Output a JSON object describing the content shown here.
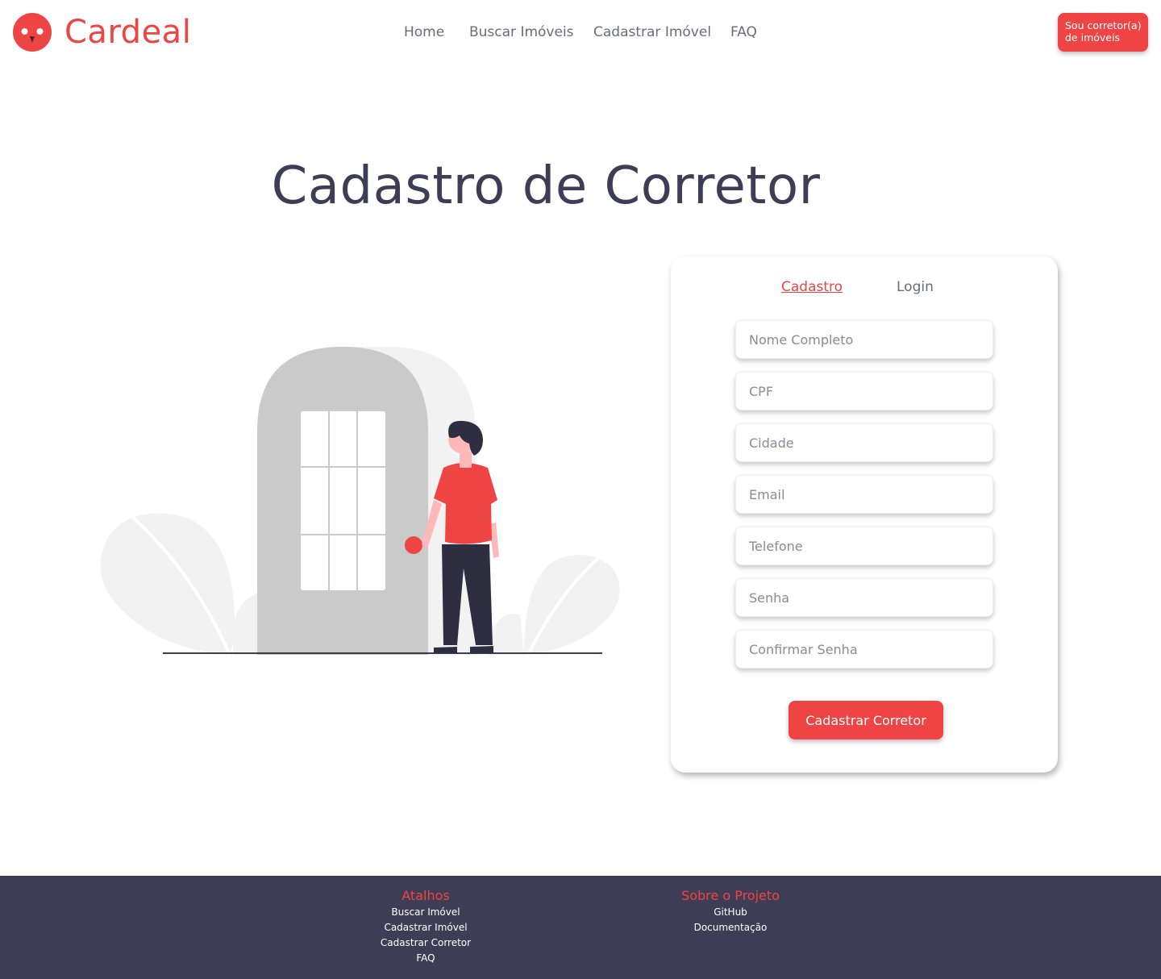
{
  "brand": {
    "name": "Cardeal",
    "color": "#ef4444",
    "logo_icon": "cardinal-bird-icon"
  },
  "nav": {
    "items": [
      {
        "label": "Home"
      },
      {
        "label": "Buscar Imóveis"
      },
      {
        "label": "Cadastrar Imóvel"
      },
      {
        "label": "FAQ"
      }
    ],
    "cta_line1": "Sou corretor(a)",
    "cta_line2": "de imóveis"
  },
  "page": {
    "title": "Cadastro de Corretor"
  },
  "form": {
    "tabs": {
      "active": "Cadastro",
      "inactive": "Login"
    },
    "fields": [
      {
        "placeholder": "Nome Completo"
      },
      {
        "placeholder": "CPF"
      },
      {
        "placeholder": "Cidade"
      },
      {
        "placeholder": "Email"
      },
      {
        "placeholder": "Telefone"
      },
      {
        "placeholder": "Senha"
      },
      {
        "placeholder": "Confirmar Senha"
      }
    ],
    "submit_label": "Cadastrar Corretor"
  },
  "footer": {
    "shortcuts_title": "Atalhos",
    "shortcuts": [
      "Buscar Imóvel",
      "Cadastrar Imóvel",
      "Cadastrar Corretor",
      "FAQ"
    ],
    "about_title": "Sobre o Projeto",
    "about_links": [
      "GitHub",
      "Documentação"
    ],
    "background": "#3f3d56"
  }
}
